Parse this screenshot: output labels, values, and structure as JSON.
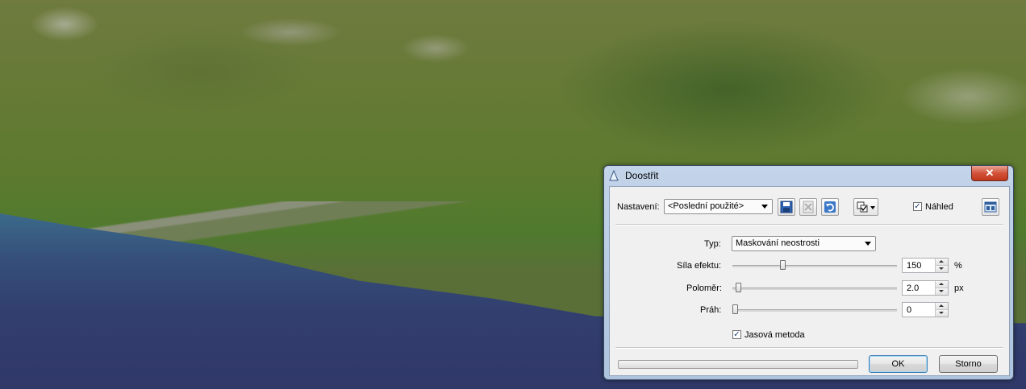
{
  "dialog": {
    "title": "Doostřit",
    "close_label": "✕",
    "settings_label": "Nastavení:",
    "settings_value": "<Poslední použité>",
    "preview_label": "Náhled",
    "preview_checked": true,
    "type_label": "Typ:",
    "type_value": "Maskování neostrosti",
    "params": [
      {
        "label": "Síla efektu:",
        "value": "150",
        "unit": "%",
        "level": 0.3
      },
      {
        "label": "Poloměr:",
        "value": "2.0",
        "unit": "px",
        "level": 0.02
      },
      {
        "label": "Práh:",
        "value": "0",
        "unit": "",
        "level": 0.0
      }
    ],
    "luminance_label": "Jasová metoda",
    "luminance_checked": true,
    "ok_label": "OK",
    "cancel_label": "Storno",
    "progress": 0
  },
  "icons": {
    "title": "triangle-icon",
    "save": "floppy-disk-icon",
    "delete": "delete-icon",
    "reset": "undo-icon",
    "options": "checkbox-menu-icon",
    "layout": "split-view-icon"
  }
}
